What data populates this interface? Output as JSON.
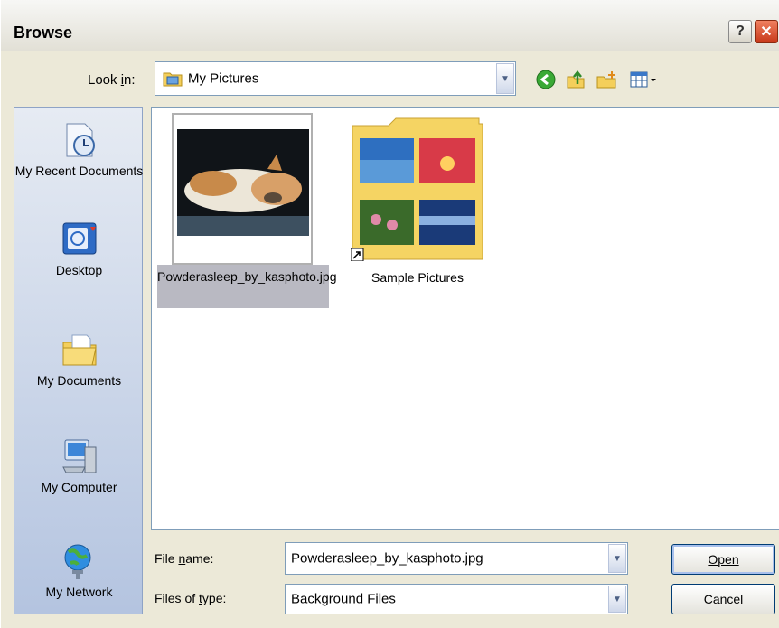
{
  "window": {
    "title": "Browse",
    "help_button": "?",
    "close_button": "✕"
  },
  "lookin": {
    "label": "Look in:",
    "value": "My Pictures"
  },
  "places": [
    {
      "label": "My Recent Documents",
      "icon": "recent-documents-icon"
    },
    {
      "label": "Desktop",
      "icon": "desktop-icon"
    },
    {
      "label": "My Documents",
      "icon": "my-documents-icon"
    },
    {
      "label": "My Computer",
      "icon": "my-computer-icon"
    },
    {
      "label": "My Network",
      "icon": "my-network-icon"
    }
  ],
  "files": [
    {
      "name": "Powderasleep_by_kasphoto.jpg",
      "selected": true,
      "type": "image"
    },
    {
      "name": "Sample Pictures",
      "selected": false,
      "type": "folder-shortcut"
    }
  ],
  "filename": {
    "label": "File name:",
    "value": "Powderasleep_by_kasphoto.jpg"
  },
  "filetype": {
    "label": "Files of type:",
    "value": "Background Files"
  },
  "buttons": {
    "open": "Open",
    "cancel": "Cancel"
  },
  "colors": {
    "dialog_bg": "#ece9d8",
    "selection": "#b9b9c2",
    "border_blue": "#7f9db9"
  }
}
